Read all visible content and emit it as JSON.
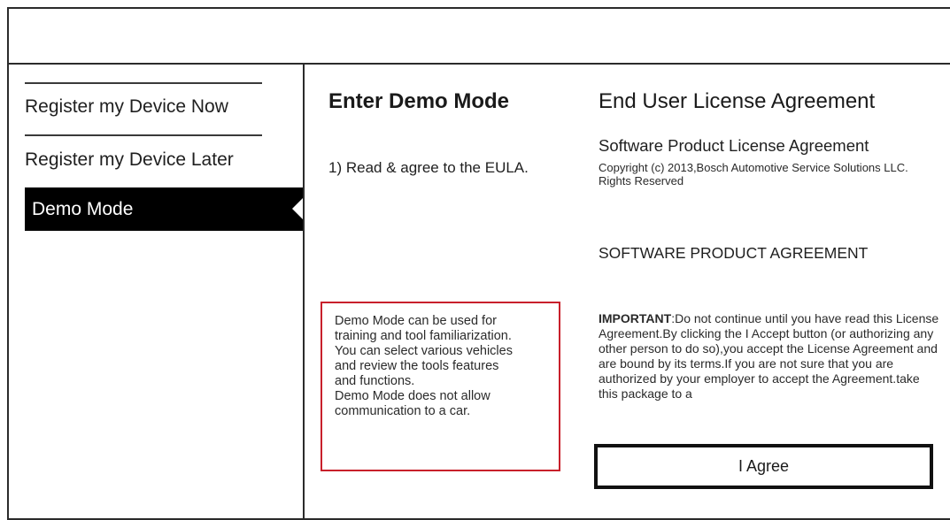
{
  "sidebar": {
    "items": [
      {
        "label": "Register my Device Now"
      },
      {
        "label": "Register my Device Later"
      },
      {
        "label": "Demo Mode"
      }
    ]
  },
  "demo": {
    "title": "Enter Demo Mode",
    "step": "1) Read & agree to the EULA.",
    "info_lines": [
      "Demo Mode can be used for",
      "training and tool familiarization.",
      "You can select various vehicles",
      "and review the tools features",
      "and functions.",
      "Demo Mode does not allow",
      "communication to a car."
    ]
  },
  "eula": {
    "title": "End User License Agreement",
    "subtitle": "Software Product License Agreement",
    "copyright": "Copyright (c) 2013,Bosch Automotive Service Solutions LLC. Rights Reserved",
    "section_heading": "SOFTWARE PRODUCT AGREEMENT",
    "body_label": "IMPORTANT",
    "body_text": ":Do not continue until you have read this License Agreement.By clicking the I Accept button (or authorizing any other person to do so),you accept the License Agreement and are bound by its terms.If you are not sure that you are authorized by your employer to accept the Agreement.take this package to a"
  },
  "actions": {
    "agree_label": "I Agree"
  },
  "colors": {
    "active_item_bg": "#000000",
    "info_border": "#c8202b"
  },
  "icons": {
    "active_item_notch": "chevron-left-notch"
  }
}
